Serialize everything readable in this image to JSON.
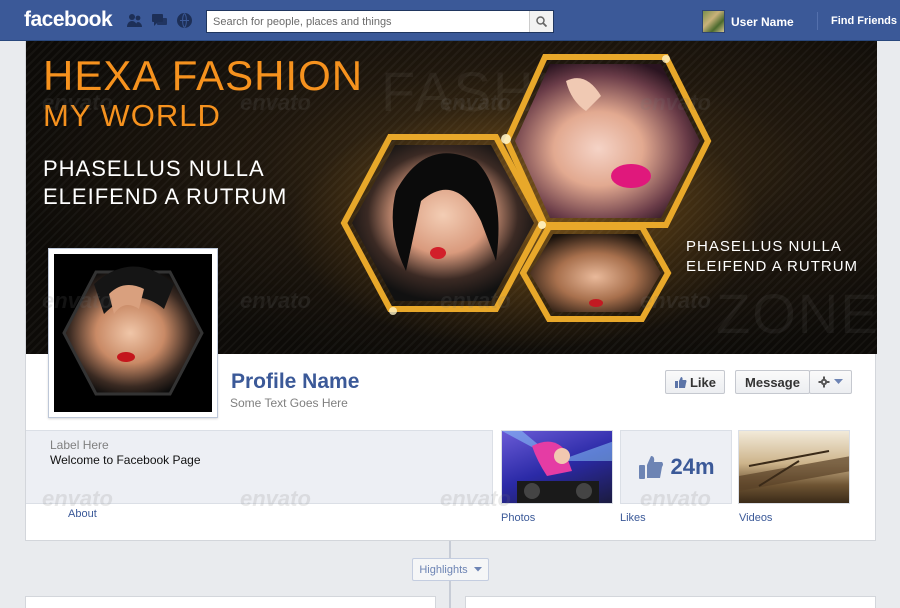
{
  "topbar": {
    "logo": "facebook",
    "search_placeholder": "Search for people, places and things",
    "user_name": "User Name",
    "find_friends": "Find Friends"
  },
  "cover": {
    "title": "HEXA FASHION",
    "subtitle": "MY WORLD",
    "tagline_line1": "PHASELLUS NULLA",
    "tagline_line2": "ELEIFEND A RUTRUM",
    "tagline_small_line1": "PHASELLUS NULLA",
    "tagline_small_line2": "ELEIFEND A RUTRUM",
    "ghost_1": "FASHION",
    "ghost_2": "ZONE"
  },
  "profile": {
    "name": "Profile Name",
    "subtitle": "Some Text Goes Here"
  },
  "actions": {
    "like_label": "Like",
    "message_label": "Message"
  },
  "about": {
    "label": "Label Here",
    "text": "Welcome to Facebook Page",
    "link": "About"
  },
  "thumbs": {
    "photos_label": "Photos",
    "likes_label": "Likes",
    "likes_count": "24m",
    "videos_label": "Videos"
  },
  "timeline": {
    "highlights_label": "Highlights"
  },
  "watermark": "envato",
  "colors": {
    "brand_blue": "#3b5998",
    "accent_orange": "#f6921e",
    "hex_gold": "#e8a82a"
  },
  "icons": [
    "friend-requests-icon",
    "messages-icon",
    "notifications-icon",
    "search-icon",
    "like-thumb-icon",
    "gear-icon",
    "chevron-down-icon"
  ]
}
